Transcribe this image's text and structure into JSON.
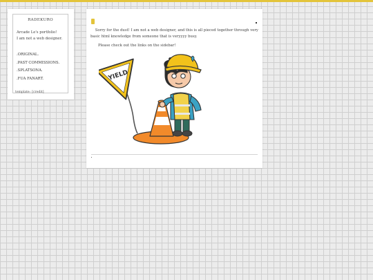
{
  "sidebar": {
    "title": "RADEKURO",
    "intro_line1": "Arcade Le's portfolio!",
    "intro_line2": "I am not a web designer.",
    "nav": [
      {
        "label": ".ORIGINAL."
      },
      {
        "label": ".PAST COMMISSIONS."
      },
      {
        "label": ".SPLATSONA."
      },
      {
        "label": ".FUA FANART."
      }
    ],
    "footer_template": "template:",
    "footer_credit": "[credit]"
  },
  "main": {
    "paragraph1": "Sorry for the dust! I am not a web designer, and this is all pieced together through very basic html knowledge from someone that is veryyyy busy.",
    "paragraph2": "Please check out the links on the sidebar!",
    "sign_text": "YIELD"
  },
  "colors": {
    "accent": "#e3c43a",
    "helmet": "#f2c21b",
    "cone": "#f28a2a",
    "jacket": "#3aa2c4",
    "vest": "#f2d24a"
  }
}
